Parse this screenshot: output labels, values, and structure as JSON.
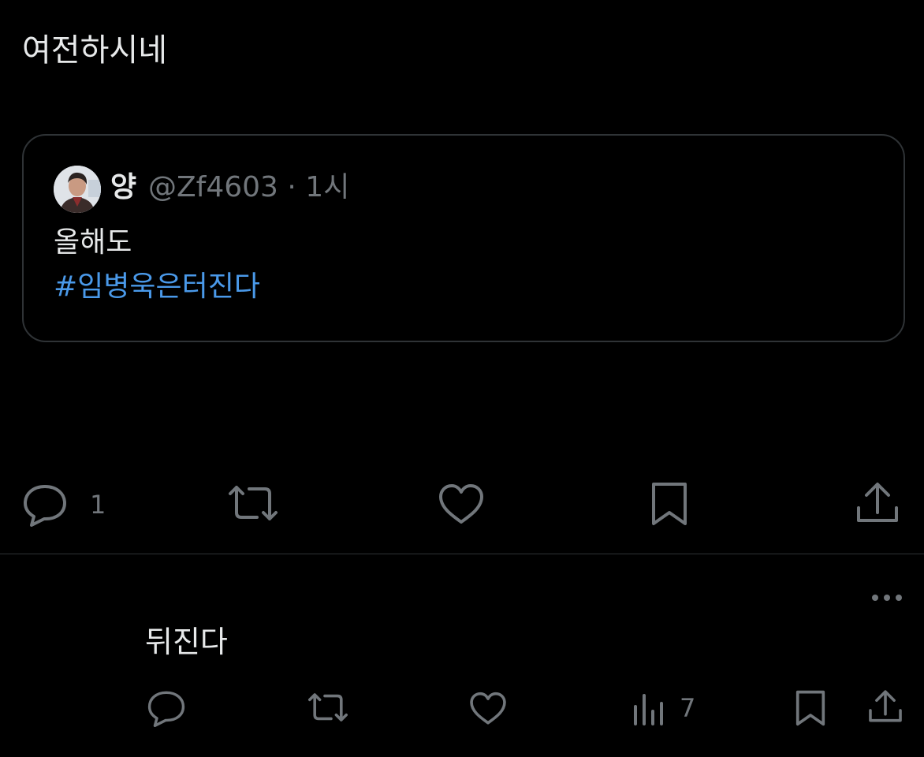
{
  "post": {
    "text": "여전하시네",
    "quote": {
      "display_name": "양",
      "handle_time": "@Zf4603 · 1시",
      "text": "올해도",
      "hashtag": "#임병욱은터진다"
    },
    "actions": {
      "reply_count": "1",
      "icons": [
        "reply-icon",
        "retweet-icon",
        "like-icon",
        "bookmark-icon",
        "share-icon"
      ]
    }
  },
  "reply": {
    "text": "뒤진다",
    "views_count": "7",
    "icons": [
      "reply-icon",
      "retweet-icon",
      "like-icon",
      "views-icon",
      "bookmark-icon",
      "share-icon",
      "more-icon"
    ]
  },
  "colors": {
    "background": "#000000",
    "text": "#e7e9ea",
    "muted": "#71767b",
    "link": "#4a99e9",
    "border": "#2f3336"
  }
}
